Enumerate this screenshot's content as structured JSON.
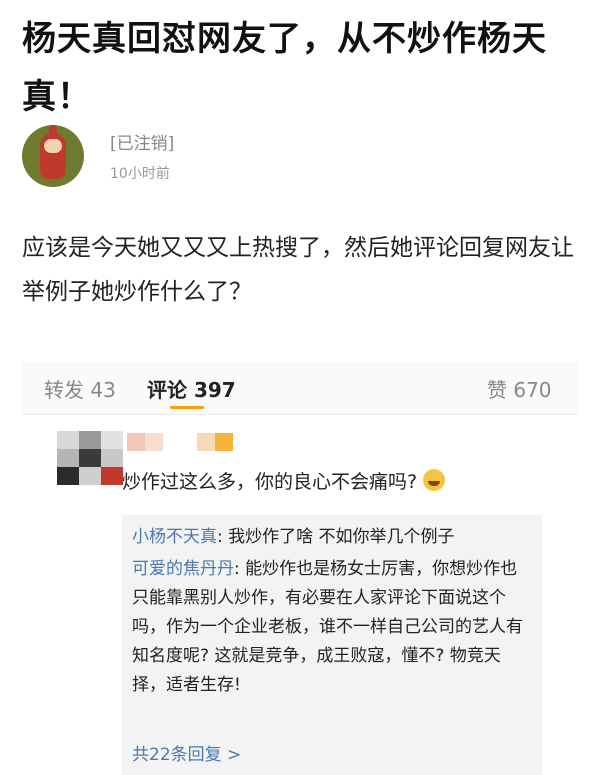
{
  "post": {
    "title": "杨天真回怼网友了，从不炒作杨天真！",
    "author": {
      "name": "[已注销]",
      "time": "10小时前",
      "avatar_icon": "teletubby-avatar"
    },
    "body": "应该是今天她又又又上热搜了，然后她评论回复网友让举例子她炒作什么了？"
  },
  "tabs": {
    "repost": "转发 43",
    "comments": "评论 397",
    "likes": "赞 670",
    "accent_color": "#f7a00a"
  },
  "comment": {
    "text": "炒作过这么多，你的良心不会痛吗?",
    "emoji": "crying-emoji"
  },
  "replies": [
    {
      "name": "小杨不天真",
      "text": ": 我炒作了啥 不如你举几个例子"
    },
    {
      "name": "可爱的焦丹丹",
      "text": ": 能炒作也是杨女士厉害，你想炒作也只能靠黑别人炒作，有必要在人家评论下面说这个吗，作为一个企业老板，谁不一样自己公司的艺人有知名度呢? 这就是竞争，成王败寇，懂不? 物竞天择，适者生存!"
    }
  ],
  "more_replies": "共22条回复 >",
  "colors": {
    "link": "#4a79b0"
  }
}
